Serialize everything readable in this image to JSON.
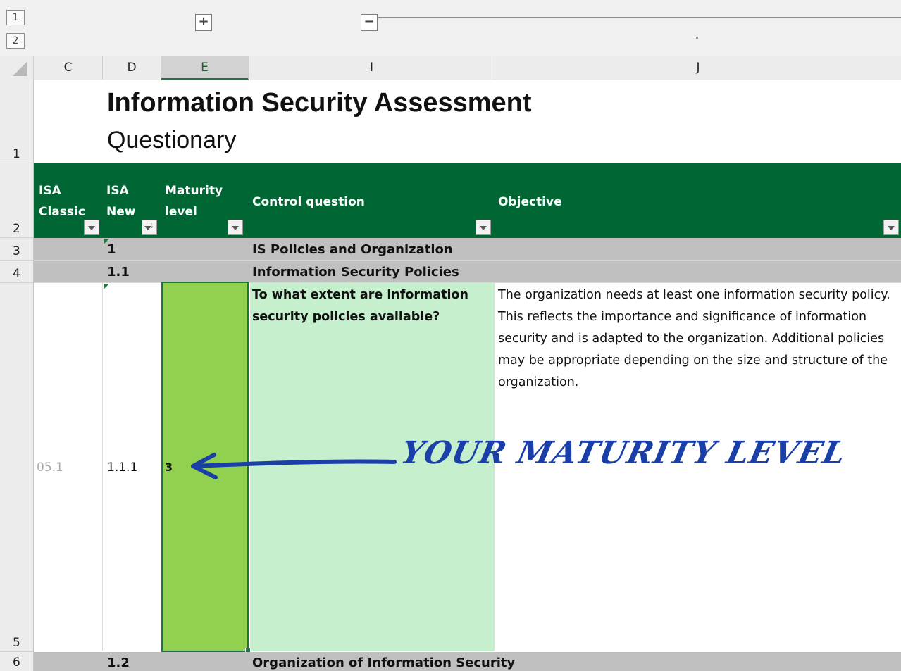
{
  "outline": {
    "level_buttons": [
      "1",
      "2"
    ],
    "group_expand": "+",
    "group_collapse": "−"
  },
  "columns": [
    "C",
    "D",
    "E",
    "I",
    "J"
  ],
  "rows": [
    "1",
    "2",
    "3",
    "4",
    "5",
    "6"
  ],
  "title": "Information Security Assessment",
  "subtitle": "Questionary",
  "header": {
    "isa_classic": [
      "ISA",
      "Classic"
    ],
    "isa_new": [
      "ISA",
      "New"
    ],
    "maturity": [
      "Maturity",
      "level"
    ],
    "control_question": "Control question",
    "objective": "Objective"
  },
  "sections": [
    {
      "isa_new": "1",
      "label": "IS Policies and Organization"
    },
    {
      "isa_new": "1.1",
      "label": "Information Security Policies"
    },
    {
      "isa_new": "1.2",
      "label": "Organization of Information Security"
    }
  ],
  "row5": {
    "isa_classic": "05.1",
    "isa_new": "1.1.1",
    "maturity_level": "3",
    "control_question": "To what extent are information security policies available?",
    "objective": "The organization needs at least one information security policy. This reflects the importance and significance of information security and is adapted to the organization. Additional policies may be appropriate depending on the size and structure of the organization."
  },
  "annotation": "YOUR MATURITY LEVEL",
  "colors": {
    "header_green": "#006633",
    "maturity_fill": "#92d050",
    "question_fill": "#c6efce",
    "section_gray": "#c0c0c0",
    "annotation_ink": "#1a3fa8"
  }
}
